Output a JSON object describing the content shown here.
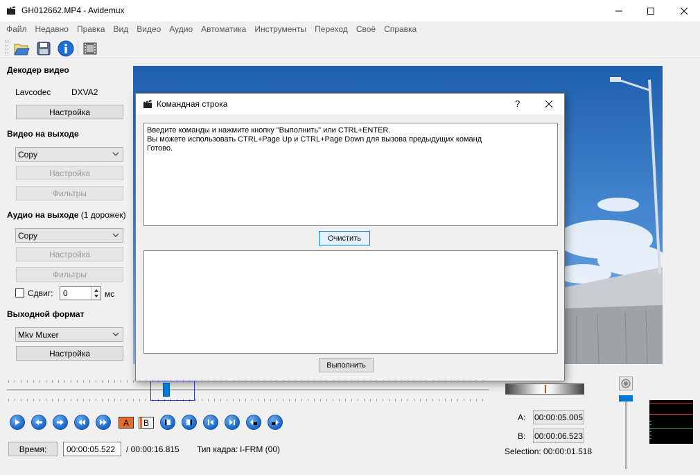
{
  "window": {
    "title": "GH012662.MP4 - Avidemux"
  },
  "menu": [
    "Файл",
    "Недавно",
    "Правка",
    "Вид",
    "Видео",
    "Аудио",
    "Автоматика",
    "Инструменты",
    "Переход",
    "Своё",
    "Справка"
  ],
  "toolbar": {
    "icons": [
      "open-icon",
      "save-icon",
      "info-icon",
      "film-icon"
    ]
  },
  "left_panel": {
    "video_decoder": {
      "title": "Декодер видео",
      "codec": "Lavcodec",
      "hw": "DXVA2",
      "settings_label": "Настройка"
    },
    "video_output": {
      "title": "Видео на выходе",
      "codec_value": "Copy",
      "settings_label": "Настройка",
      "filters_label": "Фильтры"
    },
    "audio_output": {
      "title": "Аудио на выходе",
      "tracks": "(1 дорожек)",
      "codec_value": "Copy",
      "settings_label": "Настройка",
      "filters_label": "Фильтры",
      "shift_label": "Сдвиг:",
      "shift_value": "0",
      "shift_unit": "мс"
    },
    "output_format": {
      "title": "Выходной формат",
      "muxer_value": "Mkv Muxer",
      "settings_label": "Настройка"
    }
  },
  "dialog": {
    "title": "Командная строка",
    "help": "?",
    "output_lines": [
      "Введите команды и нажмите кнопку \"Выполнить\" или CTRL+ENTER.",
      "Вы можете использовать CTRL+Page Up и CTRL+Page Down для вызова предыдущих команд",
      "Готово."
    ],
    "clear_label": "Очистить",
    "input_value": "",
    "run_label": "Выполнить"
  },
  "playback": {
    "slider_position": 0.33,
    "marker_a": "A",
    "marker_b": "B",
    "time_label": "Время:",
    "current_time": "00:00:05.522",
    "total_time": "/ 00:00:16.815",
    "frame_type_label": "Тип кадра:",
    "frame_type": "I-FRM (00)",
    "a_label": "A:",
    "a_time": "00:00:05.005",
    "b_label": "B:",
    "b_time": "00:00:06.523",
    "selection": "Selection: 00:00:01.518"
  },
  "colors": {
    "accent": "#0078d7",
    "nav_button": "#1a66c8",
    "video_sky": "#2d6ab4"
  }
}
